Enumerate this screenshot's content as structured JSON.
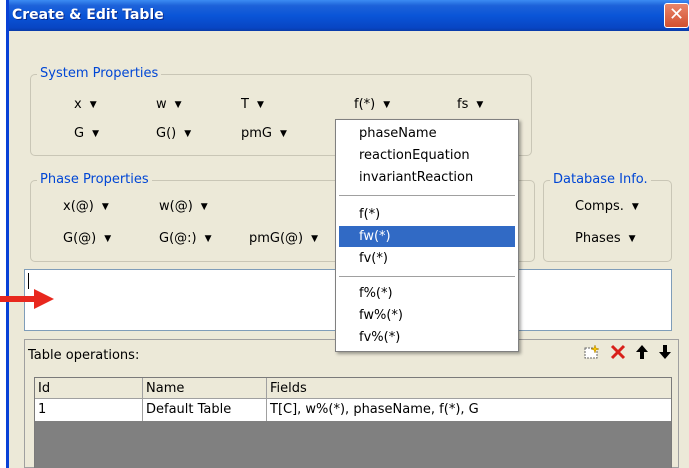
{
  "window": {
    "title": "Create & Edit Table",
    "close": "✕"
  },
  "system": {
    "legend": "System Properties",
    "row1": [
      "x",
      "w",
      "T",
      "f(*)",
      "fs"
    ],
    "row2": [
      "G",
      "G()",
      "pmG"
    ],
    "arrow": "▼"
  },
  "phase": {
    "legend": "Phase Properties",
    "row1": [
      "x(@)",
      "w(@)"
    ],
    "row2": [
      "G(@)",
      "G(@:)",
      "pmG(@)"
    ]
  },
  "database": {
    "legend": "Database Info.",
    "items": [
      "Comps.",
      "Phases"
    ]
  },
  "menu": {
    "group1": [
      "phaseName",
      "reactionEquation",
      "invariantReaction"
    ],
    "group2": [
      "f(*)",
      "fw(*)",
      "fv(*)"
    ],
    "group3": [
      "f%(*)",
      "fw%(*)",
      "fv%(*)"
    ],
    "selected": "fw(*)"
  },
  "editor": {
    "value": ""
  },
  "ops": {
    "label": "Table operations:",
    "icons": [
      "new-table-icon",
      "delete-icon",
      "move-up-icon",
      "move-down-icon"
    ],
    "columns": [
      "Id",
      "Name",
      "Fields"
    ],
    "rows": [
      [
        "1",
        "Default Table",
        "T[C], w%(*), phaseName, f(*), G"
      ]
    ]
  },
  "colors": {
    "title_bar": "#0a55d8",
    "legend": "#0046d5",
    "selection": "#316ac5",
    "red_arrow": "#e8281e",
    "close": "#d2502f"
  }
}
